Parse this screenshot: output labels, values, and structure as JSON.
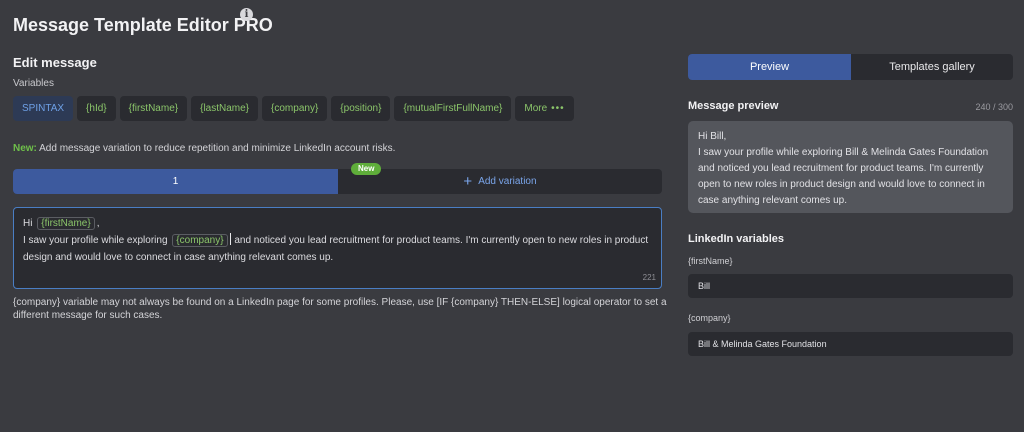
{
  "app": {
    "title": "Message Template Editor PRO",
    "info_glyph": "i"
  },
  "edit": {
    "heading": "Edit message",
    "variables_label": "Variables",
    "chips": [
      {
        "label": "SPINTAX"
      },
      {
        "label": "{hId}"
      },
      {
        "label": "{firstName}"
      },
      {
        "label": "{lastName}"
      },
      {
        "label": "{company}"
      },
      {
        "label": "{position}"
      },
      {
        "label": "{mutualFirstFullName}"
      }
    ],
    "more_label": "More",
    "more_glyph": "•••",
    "notice_prefix": "New:",
    "notice_text": " Add message variation to reduce repetition and minimize LinkedIn account risks.",
    "variation_tab_label": "1",
    "new_badge": "New",
    "add_variation_glyph": "+",
    "add_variation_label": "Add variation",
    "editor": {
      "greeting": "Hi",
      "token_firstname": "{firstName}",
      "comma": ",",
      "line2_before": "I saw your profile while exploring",
      "token_company": "{company}",
      "line2_after": "and noticed you lead recruitment for product teams. I'm currently open to new roles in product design and would love to connect in case anything relevant comes up.",
      "char_count": "221"
    },
    "warning": "{company} variable may not always be found on a LinkedIn page for some profiles. Please, use [IF {company} THEN-ELSE] logical operator to set a different message for such cases."
  },
  "right": {
    "tabs": {
      "preview": "Preview",
      "gallery": "Templates gallery"
    },
    "preview_heading": "Message preview",
    "preview_count": "240 / 300",
    "preview_line1": "Hi Bill,",
    "preview_body": "I saw your profile while exploring Bill & Melinda Gates Foundation and noticed you lead recruitment for product teams. I'm currently open to new roles in product design and would love to connect in case anything relevant comes up.",
    "linkedin_heading": "LinkedIn variables",
    "vars": [
      {
        "label": "{firstName}",
        "value": "Bill"
      },
      {
        "label": "{company}",
        "value": "Bill & Melinda Gates Foundation"
      }
    ]
  },
  "colors": {
    "accent": "#3d5a9e",
    "variable_green": "#8bc56a",
    "badge_green": "#5fae3a",
    "link_blue": "#7aa5ea"
  }
}
